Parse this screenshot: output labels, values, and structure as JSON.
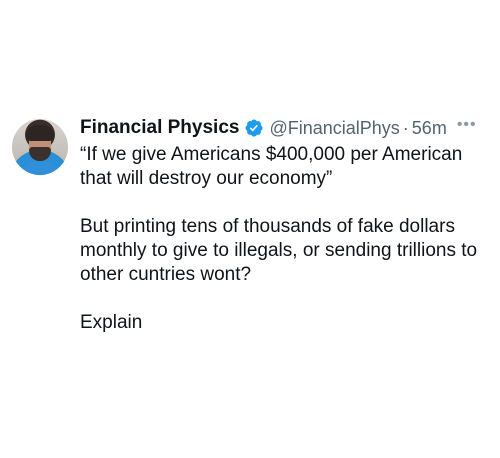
{
  "tweet": {
    "author_name": "Financial Physics",
    "handle": "@FinancialPhys",
    "separator": "·",
    "time": "56m",
    "more_icon": "more-horizontal-icon",
    "verified_icon": "verified-badge-icon",
    "paragraphs": [
      "“If we give Americans $400,000 per American that will destroy our economy”",
      "But printing tens of thousands of fake dollars monthly to give to illegals, or sending trillions to other cuntries wont?",
      "Explain"
    ]
  },
  "colors": {
    "text": "#0f1419",
    "secondary": "#536471",
    "verified": "#1d9bf0"
  }
}
